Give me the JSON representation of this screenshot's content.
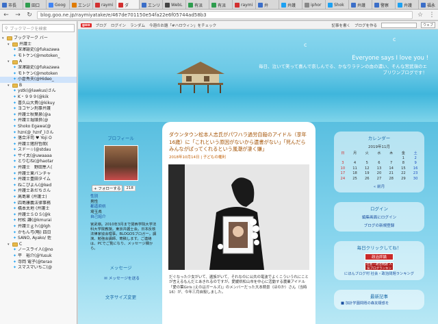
{
  "browser": {
    "tabs": [
      {
        "label": "市長",
        "color": "#3b6ec8"
      },
      {
        "label": "田口",
        "color": "#2f9d4f"
      },
      {
        "label": "Goog",
        "color": "#4285f4"
      },
      {
        "label": "エンジ",
        "color": "#e07b00"
      },
      {
        "label": "raymi",
        "color": "#d23030"
      },
      {
        "label": "ダ",
        "color": "#d23030",
        "active": true
      },
      {
        "label": "エンリ",
        "color": "#3b6ec8"
      },
      {
        "label": "WebL",
        "color": "#444444"
      },
      {
        "label": "有派",
        "color": "#2f9d4f"
      },
      {
        "label": "有派",
        "color": "#2f9d4f"
      },
      {
        "label": "raymi",
        "color": "#d23030"
      },
      {
        "label": "弁",
        "color": "#3b6ec8"
      },
      {
        "label": "弁護",
        "color": "#1da1f2"
      },
      {
        "label": "iphor",
        "color": "#888888"
      },
      {
        "label": "Shok",
        "color": "#1da1f2"
      },
      {
        "label": "弁護",
        "color": "#3b6ec8"
      },
      {
        "label": "警察",
        "color": "#3b6ec8"
      },
      {
        "label": "弁護",
        "color": "#1da1f2"
      },
      {
        "label": "福永",
        "color": "#3b6ec8"
      },
      {
        "label": "酒井",
        "color": "#3b6ec8"
      }
    ],
    "url": "blog.goo.ne.jp/raymiyatake/e/467de701150e54fa22e6f05744ad58b3"
  },
  "sidebar": {
    "search_placeholder": "ブックマークを検索",
    "items": [
      {
        "label": "ブックマーク バー",
        "type": "folder",
        "indent": 0
      },
      {
        "label": "弁護士",
        "type": "folder",
        "indent": 1
      },
      {
        "label": "深澤諭史(@fukazawa",
        "type": "tw",
        "indent": 2
      },
      {
        "label": "モトケン(@motoken_",
        "type": "tw",
        "indent": 2
      },
      {
        "label": "A",
        "type": "folder",
        "indent": 1
      },
      {
        "label": "深澤諭史(@fukazawa",
        "type": "tw",
        "indent": 2
      },
      {
        "label": "モトケン(@motoken",
        "type": "tw",
        "indent": 2
      },
      {
        "label": "小倉秀夫(@Hideo_",
        "type": "tw",
        "indent": 2,
        "selected": true
      },
      {
        "label": "B",
        "type": "folder",
        "indent": 1
      },
      {
        "label": "ystk(@lawkus)さん",
        "type": "tw",
        "indent": 2
      },
      {
        "label": "K・９９９(@kik",
        "type": "tw",
        "indent": 2
      },
      {
        "label": "喜久山大貴(@kikuy",
        "type": "tw",
        "indent": 2
      },
      {
        "label": "ヨコヤン刑事弁護",
        "type": "tw",
        "indent": 2
      },
      {
        "label": "弁護士秋葉泉(@a",
        "type": "tw",
        "indent": 2
      },
      {
        "label": "弁護士堀頭良(@",
        "type": "tw",
        "indent": 2
      },
      {
        "label": "Shoko Egawa(@",
        "type": "tw",
        "indent": 2
      },
      {
        "label": "hzn(@_hznf_)さん",
        "type": "tw",
        "indent": 2
      },
      {
        "label": "落合洋司 ♥ Yoji O",
        "type": "tw",
        "indent": 2
      },
      {
        "label": "弁護士猪狩哲朗(",
        "type": "tw",
        "indent": 2
      },
      {
        "label": "スドー☆(@stdau",
        "type": "tw",
        "indent": 2
      },
      {
        "label": "サイ太(@uwaaaa",
        "type": "tw",
        "indent": 2
      },
      {
        "label": "とりむね(@haotar",
        "type": "tw",
        "indent": 2
      },
      {
        "label": "弁護士　野田隼人(",
        "type": "tw",
        "indent": 2
      },
      {
        "label": "弁護士東パンチャ",
        "type": "tw",
        "indent": 2
      },
      {
        "label": "弁護士豊田タイム",
        "type": "tw",
        "indent": 2
      },
      {
        "label": "ねこぴよん(@ked",
        "type": "tw",
        "indent": 2
      },
      {
        "label": "弁護士あだちさん",
        "type": "tw",
        "indent": 2
      },
      {
        "label": "高島章 (弁護士)",
        "type": "tw",
        "indent": 2
      },
      {
        "label": "四島康義法律事務",
        "type": "tw",
        "indent": 2
      },
      {
        "label": "橋本太地 (弁護士",
        "type": "tw",
        "indent": 2
      },
      {
        "label": "弁護士ＳＯＳ(@k",
        "type": "tw",
        "indent": 2
      },
      {
        "label": "村松 謙(@kmurai",
        "type": "tw",
        "indent": 2
      },
      {
        "label": "弁護士ｇｈ(@lgh",
        "type": "tw",
        "indent": 2
      },
      {
        "label": "かもん弓(略) 四日",
        "type": "tw",
        "indent": 2
      },
      {
        "label": "SANO, Ayako/ 佐",
        "type": "tw",
        "indent": 2
      },
      {
        "label": "C",
        "type": "folder",
        "indent": 1
      },
      {
        "label": "ノースライ人(@no",
        "type": "tw",
        "indent": 2
      },
      {
        "label": "平　裕介(@Yusuk",
        "type": "tw",
        "indent": 2
      },
      {
        "label": "寺岡 電子(@terao",
        "type": "tw",
        "indent": 2
      },
      {
        "label": "スマスマいちご(@",
        "type": "tw",
        "indent": 2
      }
    ]
  },
  "goo_bar": {
    "logo": "goo",
    "links": [
      "ブログ",
      "ログイン",
      "ランダム",
      "今週のお題「#ハロウィン」をチェック"
    ],
    "right_links": [
      "記事を書く",
      "ブログを作る"
    ],
    "search_option": "ウェブ"
  },
  "header": {
    "title": "Everyone says I love you !",
    "subtitle": "毎日、泣いて笑って喜んで哀しんでる、かなりラテンの血の濃い、そんな宮武嶺のエブリワンブログです！"
  },
  "left_col": {
    "profile_title": "プロフィール",
    "follow_label": "フォローする",
    "follow_count": "218",
    "profile_lines": [
      {
        "text": "性別",
        "link": true
      },
      {
        "text": "男性",
        "link": false
      },
      {
        "text": "都道府県",
        "link": true
      },
      {
        "text": "埼玉県",
        "link": false
      },
      {
        "text": "自己紹介",
        "link": true
      }
    ],
    "bio": "宮武嶺。2010年3月まで関西学院大学法科大学院教授。東京弁護士会。日本反核法律家協会理事。BLOGOSブロガー。講演、勉強会講師、寄稿します。ご連絡は、PCでご覧になり、メッセージ欄から。",
    "message_title": "メッセージ",
    "message_link": "メッセージを送る",
    "textsize_title": "文字サイズ変更"
  },
  "post": {
    "title": "ダウンタウン松本人志氏がパワハラ過労自殺のアイドル（享年16歳）に「これという原因がないから遺書がない」「死んだらみんながばってくれるという風潮が凄く嫌」",
    "date": "2018年10月14日",
    "category": "子どもの権利",
    "image_caption": "",
    "text": "だぐなった少女がいて、遺族がいて、それなのに公共の電波でよくこういうれにことが言えるもんだとあきれるのですが。愛媛県松山市を中心に活動する農業アイドル「愛の葉Girls (えのはガールズ)」のメンバーだった大本萌景（ほのか）さん（当時16）が、今年三月自殺しました。"
  },
  "right_col": {
    "calendar_title": "カレンダー",
    "calendar_month": "2019年11月",
    "weekdays": [
      "日",
      "月",
      "火",
      "水",
      "木",
      "金",
      "土"
    ],
    "weeks": [
      [
        "",
        "",
        "",
        "",
        "",
        "1",
        "2"
      ],
      [
        "3",
        "4",
        "5",
        "6",
        "7",
        "8",
        "9"
      ],
      [
        "10",
        "11",
        "12",
        "13",
        "14",
        "15",
        "16"
      ],
      [
        "17",
        "18",
        "19",
        "20",
        "21",
        "22",
        "23"
      ],
      [
        "24",
        "25",
        "26",
        "27",
        "28",
        "29",
        "30"
      ]
    ],
    "back_month": "前月",
    "login_title": "ログイン",
    "login_links": [
      "編集画面にログイン",
      "ブログの新規登録"
    ],
    "click_title": "毎日クリックしてね！",
    "rank_label": "政治評論",
    "rank_label2": "社会・政治問題 人気ブログランキング",
    "rank_text": "にほんブログ村 社会・政治問題ランキング",
    "recent_title": "最新記事",
    "recent_items": [
      "■ 加計学園問題の森友疑惑を"
    ]
  }
}
